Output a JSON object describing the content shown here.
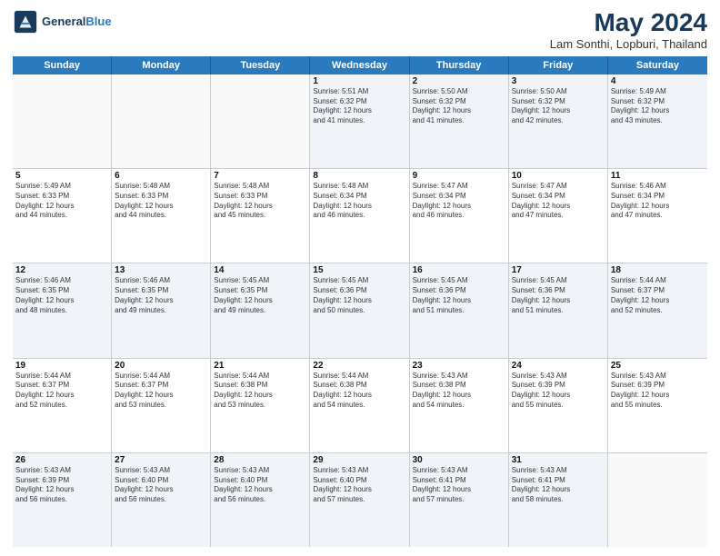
{
  "header": {
    "logo_line1": "General",
    "logo_line2": "Blue",
    "month": "May 2024",
    "location": "Lam Sonthi, Lopburi, Thailand"
  },
  "days_of_week": [
    "Sunday",
    "Monday",
    "Tuesday",
    "Wednesday",
    "Thursday",
    "Friday",
    "Saturday"
  ],
  "rows": [
    {
      "cells": [
        {
          "day": "",
          "info": ""
        },
        {
          "day": "",
          "info": ""
        },
        {
          "day": "",
          "info": ""
        },
        {
          "day": "1",
          "info": "Sunrise: 5:51 AM\nSunset: 6:32 PM\nDaylight: 12 hours\nand 41 minutes."
        },
        {
          "day": "2",
          "info": "Sunrise: 5:50 AM\nSunset: 6:32 PM\nDaylight: 12 hours\nand 41 minutes."
        },
        {
          "day": "3",
          "info": "Sunrise: 5:50 AM\nSunset: 6:32 PM\nDaylight: 12 hours\nand 42 minutes."
        },
        {
          "day": "4",
          "info": "Sunrise: 5:49 AM\nSunset: 6:32 PM\nDaylight: 12 hours\nand 43 minutes."
        }
      ]
    },
    {
      "cells": [
        {
          "day": "5",
          "info": "Sunrise: 5:49 AM\nSunset: 6:33 PM\nDaylight: 12 hours\nand 44 minutes."
        },
        {
          "day": "6",
          "info": "Sunrise: 5:48 AM\nSunset: 6:33 PM\nDaylight: 12 hours\nand 44 minutes."
        },
        {
          "day": "7",
          "info": "Sunrise: 5:48 AM\nSunset: 6:33 PM\nDaylight: 12 hours\nand 45 minutes."
        },
        {
          "day": "8",
          "info": "Sunrise: 5:48 AM\nSunset: 6:34 PM\nDaylight: 12 hours\nand 46 minutes."
        },
        {
          "day": "9",
          "info": "Sunrise: 5:47 AM\nSunset: 6:34 PM\nDaylight: 12 hours\nand 46 minutes."
        },
        {
          "day": "10",
          "info": "Sunrise: 5:47 AM\nSunset: 6:34 PM\nDaylight: 12 hours\nand 47 minutes."
        },
        {
          "day": "11",
          "info": "Sunrise: 5:46 AM\nSunset: 6:34 PM\nDaylight: 12 hours\nand 47 minutes."
        }
      ]
    },
    {
      "cells": [
        {
          "day": "12",
          "info": "Sunrise: 5:46 AM\nSunset: 6:35 PM\nDaylight: 12 hours\nand 48 minutes."
        },
        {
          "day": "13",
          "info": "Sunrise: 5:46 AM\nSunset: 6:35 PM\nDaylight: 12 hours\nand 49 minutes."
        },
        {
          "day": "14",
          "info": "Sunrise: 5:45 AM\nSunset: 6:35 PM\nDaylight: 12 hours\nand 49 minutes."
        },
        {
          "day": "15",
          "info": "Sunrise: 5:45 AM\nSunset: 6:36 PM\nDaylight: 12 hours\nand 50 minutes."
        },
        {
          "day": "16",
          "info": "Sunrise: 5:45 AM\nSunset: 6:36 PM\nDaylight: 12 hours\nand 51 minutes."
        },
        {
          "day": "17",
          "info": "Sunrise: 5:45 AM\nSunset: 6:36 PM\nDaylight: 12 hours\nand 51 minutes."
        },
        {
          "day": "18",
          "info": "Sunrise: 5:44 AM\nSunset: 6:37 PM\nDaylight: 12 hours\nand 52 minutes."
        }
      ]
    },
    {
      "cells": [
        {
          "day": "19",
          "info": "Sunrise: 5:44 AM\nSunset: 6:37 PM\nDaylight: 12 hours\nand 52 minutes."
        },
        {
          "day": "20",
          "info": "Sunrise: 5:44 AM\nSunset: 6:37 PM\nDaylight: 12 hours\nand 53 minutes."
        },
        {
          "day": "21",
          "info": "Sunrise: 5:44 AM\nSunset: 6:38 PM\nDaylight: 12 hours\nand 53 minutes."
        },
        {
          "day": "22",
          "info": "Sunrise: 5:44 AM\nSunset: 6:38 PM\nDaylight: 12 hours\nand 54 minutes."
        },
        {
          "day": "23",
          "info": "Sunrise: 5:43 AM\nSunset: 6:38 PM\nDaylight: 12 hours\nand 54 minutes."
        },
        {
          "day": "24",
          "info": "Sunrise: 5:43 AM\nSunset: 6:39 PM\nDaylight: 12 hours\nand 55 minutes."
        },
        {
          "day": "25",
          "info": "Sunrise: 5:43 AM\nSunset: 6:39 PM\nDaylight: 12 hours\nand 55 minutes."
        }
      ]
    },
    {
      "cells": [
        {
          "day": "26",
          "info": "Sunrise: 5:43 AM\nSunset: 6:39 PM\nDaylight: 12 hours\nand 56 minutes."
        },
        {
          "day": "27",
          "info": "Sunrise: 5:43 AM\nSunset: 6:40 PM\nDaylight: 12 hours\nand 56 minutes."
        },
        {
          "day": "28",
          "info": "Sunrise: 5:43 AM\nSunset: 6:40 PM\nDaylight: 12 hours\nand 56 minutes."
        },
        {
          "day": "29",
          "info": "Sunrise: 5:43 AM\nSunset: 6:40 PM\nDaylight: 12 hours\nand 57 minutes."
        },
        {
          "day": "30",
          "info": "Sunrise: 5:43 AM\nSunset: 6:41 PM\nDaylight: 12 hours\nand 57 minutes."
        },
        {
          "day": "31",
          "info": "Sunrise: 5:43 AM\nSunset: 6:41 PM\nDaylight: 12 hours\nand 58 minutes."
        },
        {
          "day": "",
          "info": ""
        }
      ]
    }
  ]
}
